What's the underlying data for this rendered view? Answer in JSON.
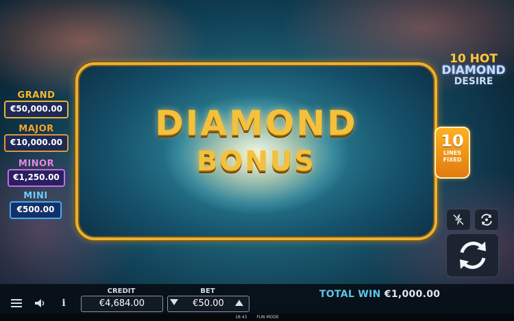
{
  "bonus": {
    "line1": "DIAMOND",
    "line2": "BONUS"
  },
  "jackpots": {
    "grand": {
      "label": "GRAND",
      "value": "€50,000.00"
    },
    "major": {
      "label": "MAJOR",
      "value": "€10,000.00"
    },
    "minor": {
      "label": "MINOR",
      "value": "€1,250.00"
    },
    "mini": {
      "label": "MINI",
      "value": "€500.00"
    }
  },
  "logo": {
    "line1": "10 HOT",
    "line2": "DIAMOND",
    "line3": "DESIRE"
  },
  "lines_badge": {
    "number": "10",
    "line_a": "LINES",
    "line_b": "FIXED"
  },
  "bottom": {
    "credit_label": "CREDIT",
    "credit_value": "€4,684.00",
    "bet_label": "BET",
    "bet_value": "€50.00",
    "total_win_label": "TOTAL WIN",
    "total_win_value": "€1,000.00"
  },
  "status": {
    "time": "18:43",
    "mode": "FUN MODE"
  },
  "icons": {
    "menu": "menu-icon",
    "sound": "speaker-icon",
    "info": "info-icon",
    "turbo": "lightning-off-icon",
    "autoplay": "autoplay-icon",
    "spin": "spin-arrows-icon"
  },
  "colors": {
    "frame": "#e7b23a",
    "title": "#f3c13b",
    "total_win_label": "#5bc6e8",
    "lines_badge": "#ffb020"
  }
}
